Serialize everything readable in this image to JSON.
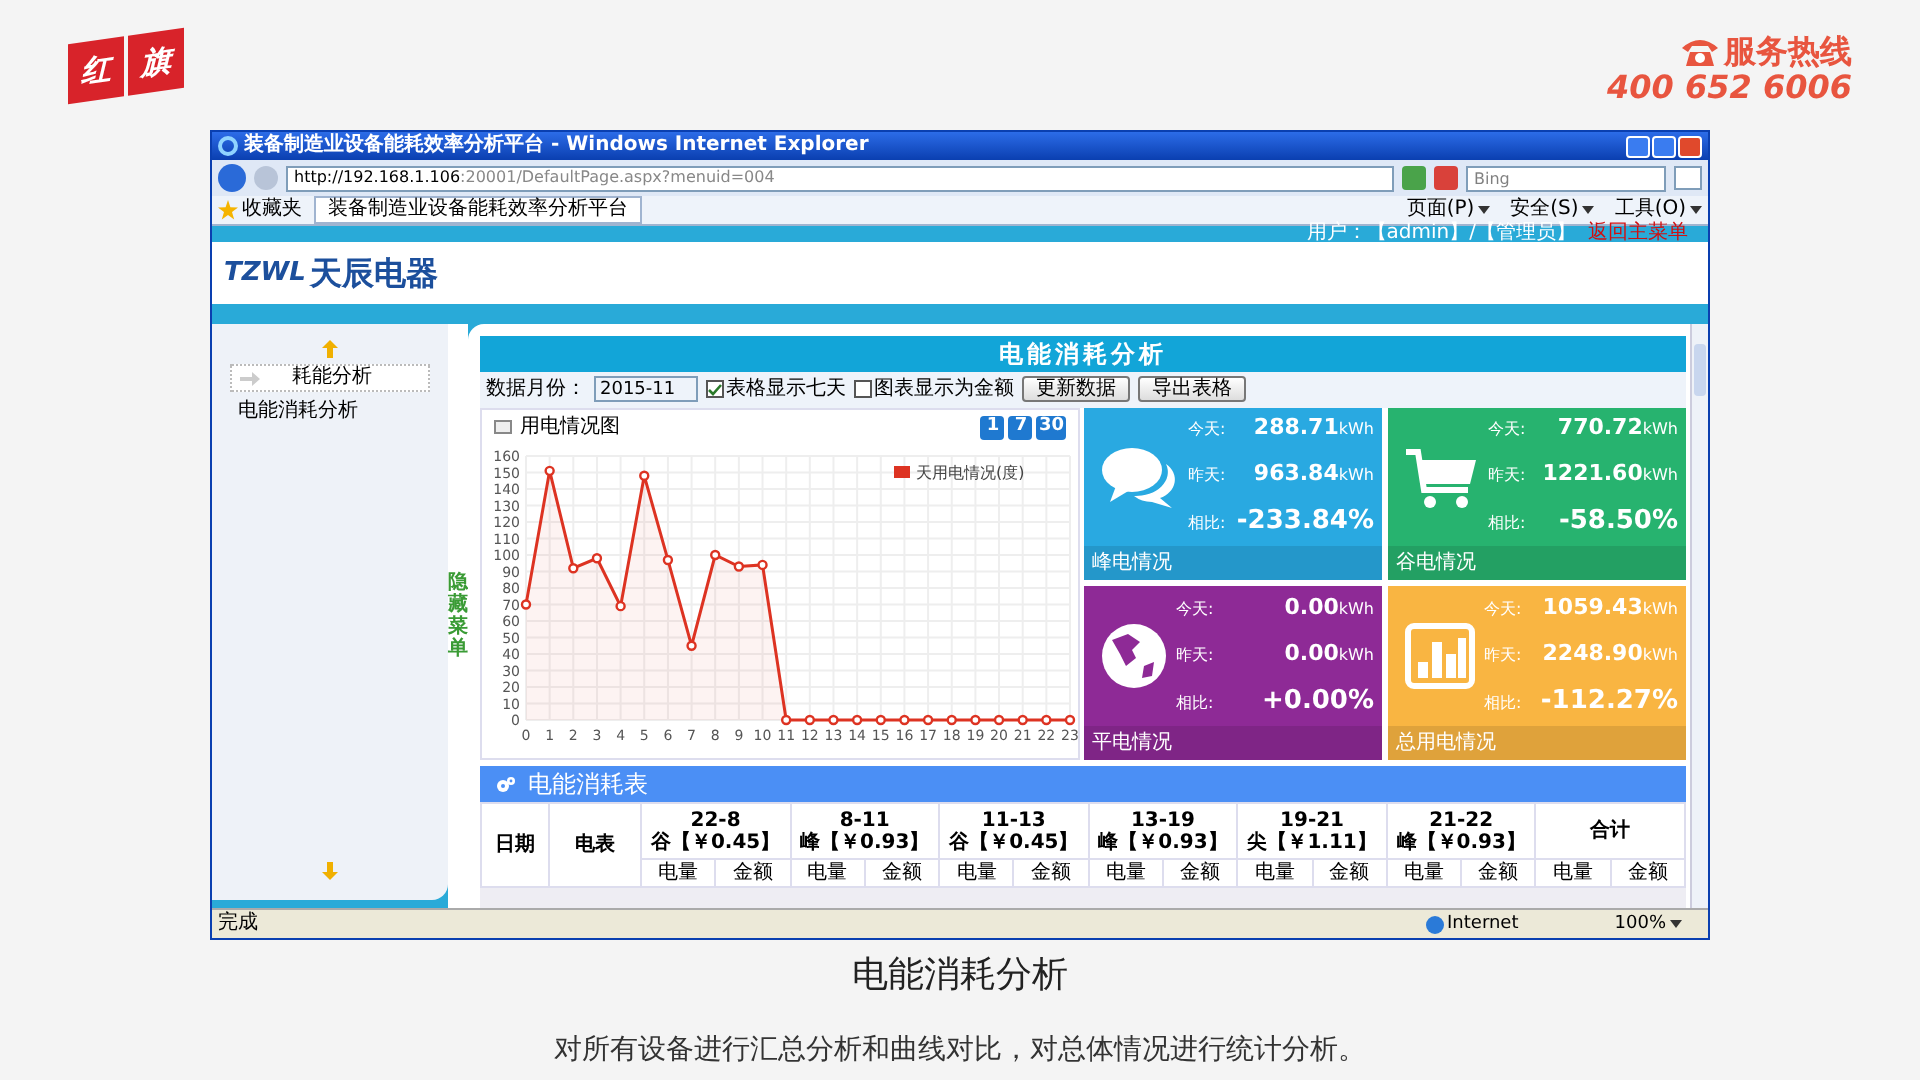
{
  "brand": {
    "logo_chars": [
      "红",
      "旗"
    ],
    "hotline_label": "服务热线",
    "hotline_number": "400 652 6006"
  },
  "browser": {
    "title": "装备制造业设备能耗效率分析平台 - Windows Internet Explorer",
    "url_host": "http://192.168.1.106",
    "url_path": ":20001/DefaultPage.aspx?menuid=004",
    "search_placeholder": "Bing",
    "favorites": "收藏夹",
    "tab": "装备制造业设备能耗效率分析平台",
    "commands": [
      "页面(P)",
      "安全(S)",
      "工具(O)"
    ],
    "status": "完成",
    "zone": "Internet",
    "zoom": "100%"
  },
  "header": {
    "logo_mark": "TZWL",
    "company": "天辰电器",
    "user": "用户：【admin】/【管理员】",
    "back_link": "返回主菜单"
  },
  "sidebar": {
    "items": [
      {
        "label": "耗能分析",
        "selected": true
      },
      {
        "label": "电能消耗分析",
        "selected": false
      }
    ],
    "toggle": "隐藏菜单"
  },
  "panel": {
    "title": "电能消耗分析",
    "toolbar": {
      "month_label": "数据月份：",
      "month": "2015-11",
      "checks": [
        {
          "label": "表格显示七天",
          "checked": true
        },
        {
          "label": "图表显示为金额",
          "checked": false
        }
      ],
      "buttons": [
        "更新数据",
        "导出表格"
      ]
    },
    "chart": {
      "title": "用电情况图",
      "ranges": [
        "1",
        "7",
        "30"
      ],
      "chart_data": {
        "type": "area",
        "x": [
          0,
          1,
          2,
          3,
          4,
          5,
          6,
          7,
          8,
          9,
          10,
          11,
          12,
          13,
          14,
          15,
          16,
          17,
          18,
          19,
          20,
          21,
          22,
          23
        ],
        "series": [
          {
            "name": "天用电情况(度)",
            "color": "#dd3322",
            "values": [
              70,
              151,
              92,
              98,
              69,
              148,
              97,
              45,
              100,
              93,
              94,
              0,
              0,
              0,
              0,
              0,
              0,
              0,
              0,
              0,
              0,
              0,
              0,
              0
            ]
          }
        ],
        "xlim": [
          0,
          23
        ],
        "grid": true,
        "ylim": [
          0,
          160
        ],
        "yticks": [
          0,
          10,
          20,
          30,
          40,
          50,
          60,
          70,
          80,
          90,
          100,
          110,
          120,
          130,
          140,
          150,
          160
        ],
        "xticks": [
          0,
          1,
          2,
          3,
          4,
          5,
          6,
          7,
          8,
          9,
          10,
          11,
          12,
          13,
          14,
          15,
          16,
          17,
          18,
          19,
          20,
          21,
          22,
          23
        ]
      }
    },
    "tiles": [
      {
        "kind": "chat",
        "color": "#29a9e1",
        "label": "峰电情况",
        "rows": [
          {
            "label": "今天:",
            "value": "288.71",
            "unit": "kWh"
          },
          {
            "label": "昨天:",
            "value": "963.84",
            "unit": "kWh"
          },
          {
            "label": "相比:",
            "value": "-233.84%"
          }
        ]
      },
      {
        "kind": "cart",
        "color": "#27b36f",
        "label": "谷电情况",
        "rows": [
          {
            "label": "今天:",
            "value": "770.72",
            "unit": "kWh"
          },
          {
            "label": "昨天:",
            "value": "1221.60",
            "unit": "kWh"
          },
          {
            "label": "相比:",
            "value": "-58.50%"
          }
        ]
      },
      {
        "kind": "globe",
        "color": "#8e2a96",
        "label": "平电情况",
        "rows": [
          {
            "label": "今天:",
            "value": "0.00",
            "unit": "kWh"
          },
          {
            "label": "昨天:",
            "value": "0.00",
            "unit": "kWh"
          },
          {
            "label": "相比:",
            "value": "+0.00%"
          }
        ]
      },
      {
        "kind": "bars",
        "color": "#f9b542",
        "label": "总用电情况",
        "rows": [
          {
            "label": "今天:",
            "value": "1059.43",
            "unit": "kWh"
          },
          {
            "label": "昨天:",
            "value": "2248.90",
            "unit": "kWh"
          },
          {
            "label": "相比:",
            "value": "-112.27%"
          }
        ]
      }
    ],
    "table": {
      "title": "电能消耗表",
      "date": "日期",
      "meter": "电表",
      "periods": [
        {
          "range": "22-8",
          "rate": "谷【￥0.45】",
          "sub": [
            "电量",
            "金额"
          ]
        },
        {
          "range": "8-11",
          "rate": "峰【￥0.93】",
          "sub": [
            "电量",
            "金额"
          ]
        },
        {
          "range": "11-13",
          "rate": "谷【￥0.45】",
          "sub": [
            "电量",
            "金额"
          ]
        },
        {
          "range": "13-19",
          "rate": "峰【￥0.93】",
          "sub": [
            "电量",
            "金额"
          ]
        },
        {
          "range": "19-21",
          "rate": "尖【￥1.11】",
          "sub": [
            "电量",
            "金额"
          ]
        },
        {
          "range": "21-22",
          "rate": "峰【￥0.93】",
          "sub": [
            "电量",
            "金额"
          ]
        }
      ],
      "total": "合计",
      "total_sub": [
        "电量",
        "金额"
      ]
    }
  },
  "caption": {
    "title": "电能消耗分析",
    "text": "对所有设备进行汇总分析和曲线对比，对总体情况进行统计分析。"
  }
}
